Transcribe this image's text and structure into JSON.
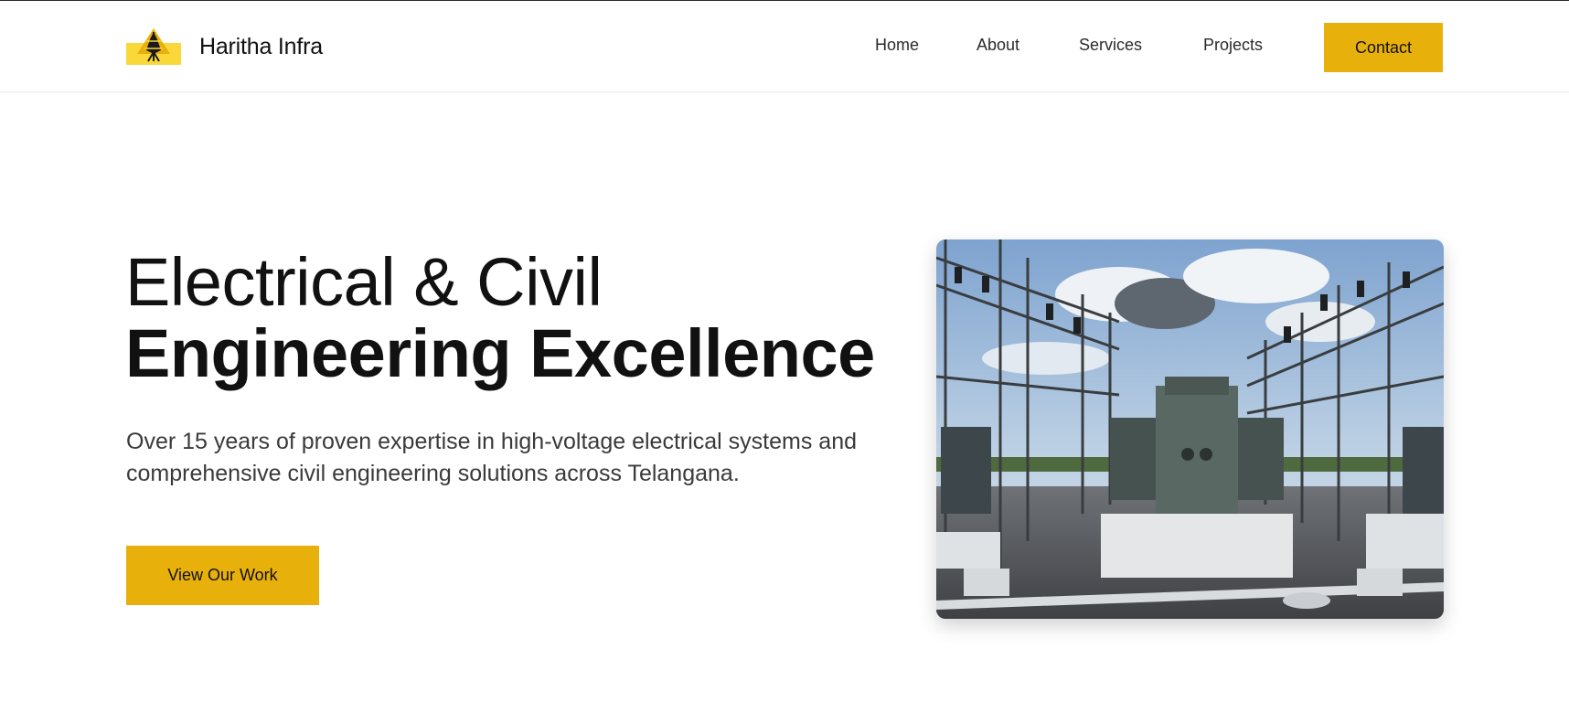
{
  "brand": {
    "name": "Haritha Infra",
    "logo_icon": "pylon-logo-icon",
    "logo_color": "#fbd83a"
  },
  "nav": {
    "items": [
      {
        "label": "Home"
      },
      {
        "label": "About"
      },
      {
        "label": "Services"
      },
      {
        "label": "Projects"
      }
    ],
    "contact_label": "Contact"
  },
  "hero": {
    "title_line1": "Electrical & Civil",
    "title_line2": "Engineering Excellence",
    "description": "Over 15 years of proven expertise in high-voltage electrical systems and comprehensive civil engineering solutions across Telangana.",
    "cta_label": "View Our Work",
    "image_subject": "electrical substation with transformer"
  },
  "colors": {
    "accent": "#e8b00b",
    "text": "#111111",
    "muted_text": "#3a3a3a",
    "border": "#e6e6e6"
  }
}
